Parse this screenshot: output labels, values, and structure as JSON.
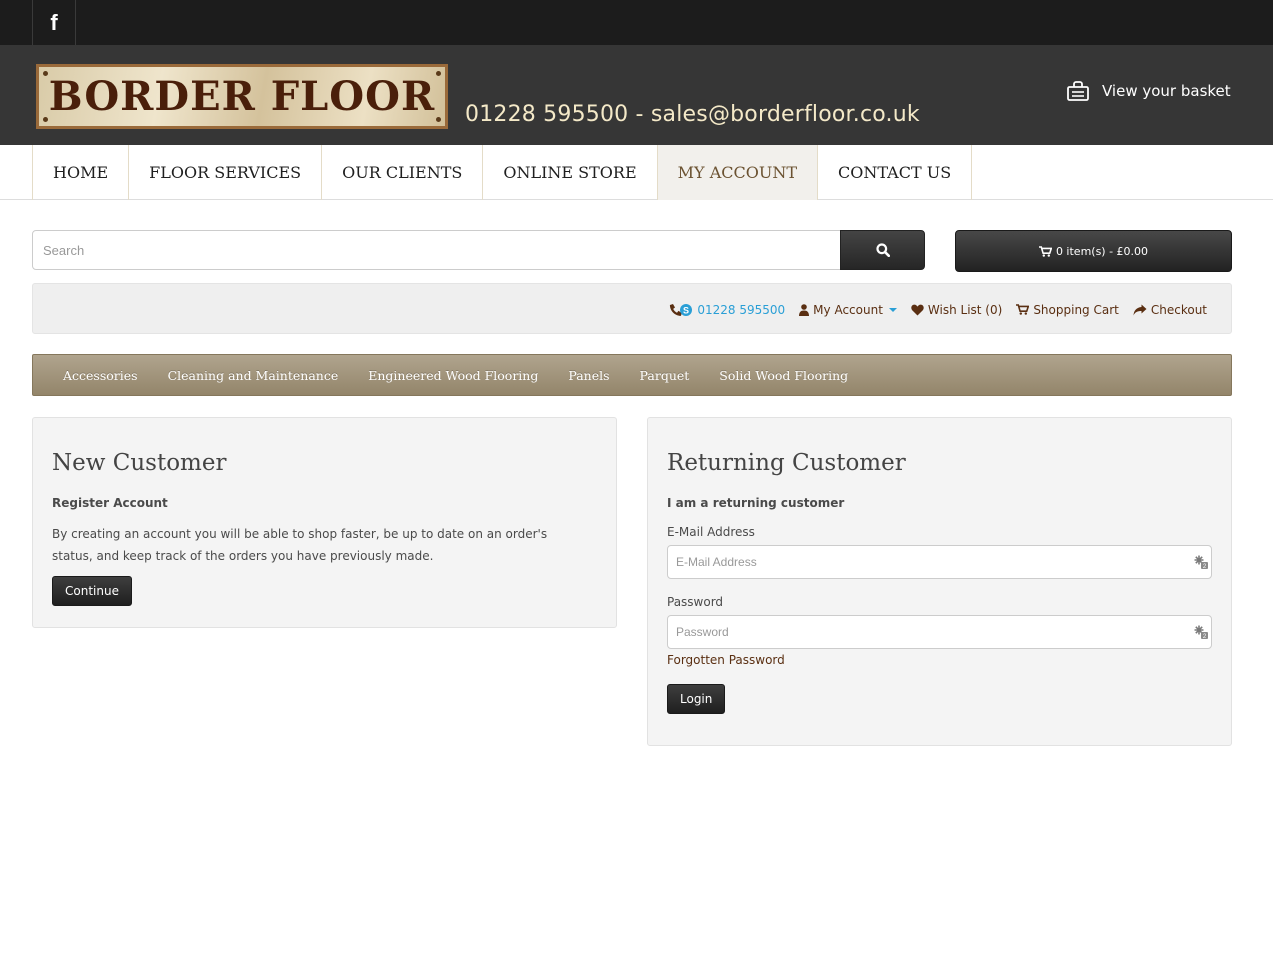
{
  "social": {
    "facebook": "f"
  },
  "header": {
    "logo": "BORDER FLOOR",
    "contact": "01228 595500 - sales@borderfloor.co.uk",
    "basket": "View your basket"
  },
  "mainnav": [
    "HOME",
    "FLOOR SERVICES",
    "OUR CLIENTS",
    "ONLINE STORE",
    "MY ACCOUNT",
    "CONTACT US"
  ],
  "search": {
    "placeholder": "Search"
  },
  "cart": {
    "label": "0 item(s) - £0.00"
  },
  "toplinks": {
    "phone": "01228 595500",
    "account": "My Account",
    "wishlist": "Wish List (0)",
    "cart": "Shopping Cart",
    "checkout": "Checkout"
  },
  "categories": [
    "Accessories",
    "Cleaning and Maintenance",
    "Engineered Wood Flooring",
    "Panels",
    "Parquet",
    "Solid Wood Flooring"
  ],
  "new_customer": {
    "title": "New Customer",
    "subtitle": "Register Account",
    "description": "By creating an account you will be able to shop faster, be up to date on an order's status, and keep track of the orders you have previously made.",
    "button": "Continue"
  },
  "returning_customer": {
    "title": "Returning Customer",
    "subtitle": "I am a returning customer",
    "email_label": "E-Mail Address",
    "email_placeholder": "E-Mail Address",
    "password_label": "Password",
    "password_placeholder": "Password",
    "forgotten": "Forgotten Password",
    "button": "Login"
  },
  "colors": {
    "accent": "#2a9fd6",
    "brown_link": "#5a2f12",
    "category_bar": "#a3967d"
  }
}
